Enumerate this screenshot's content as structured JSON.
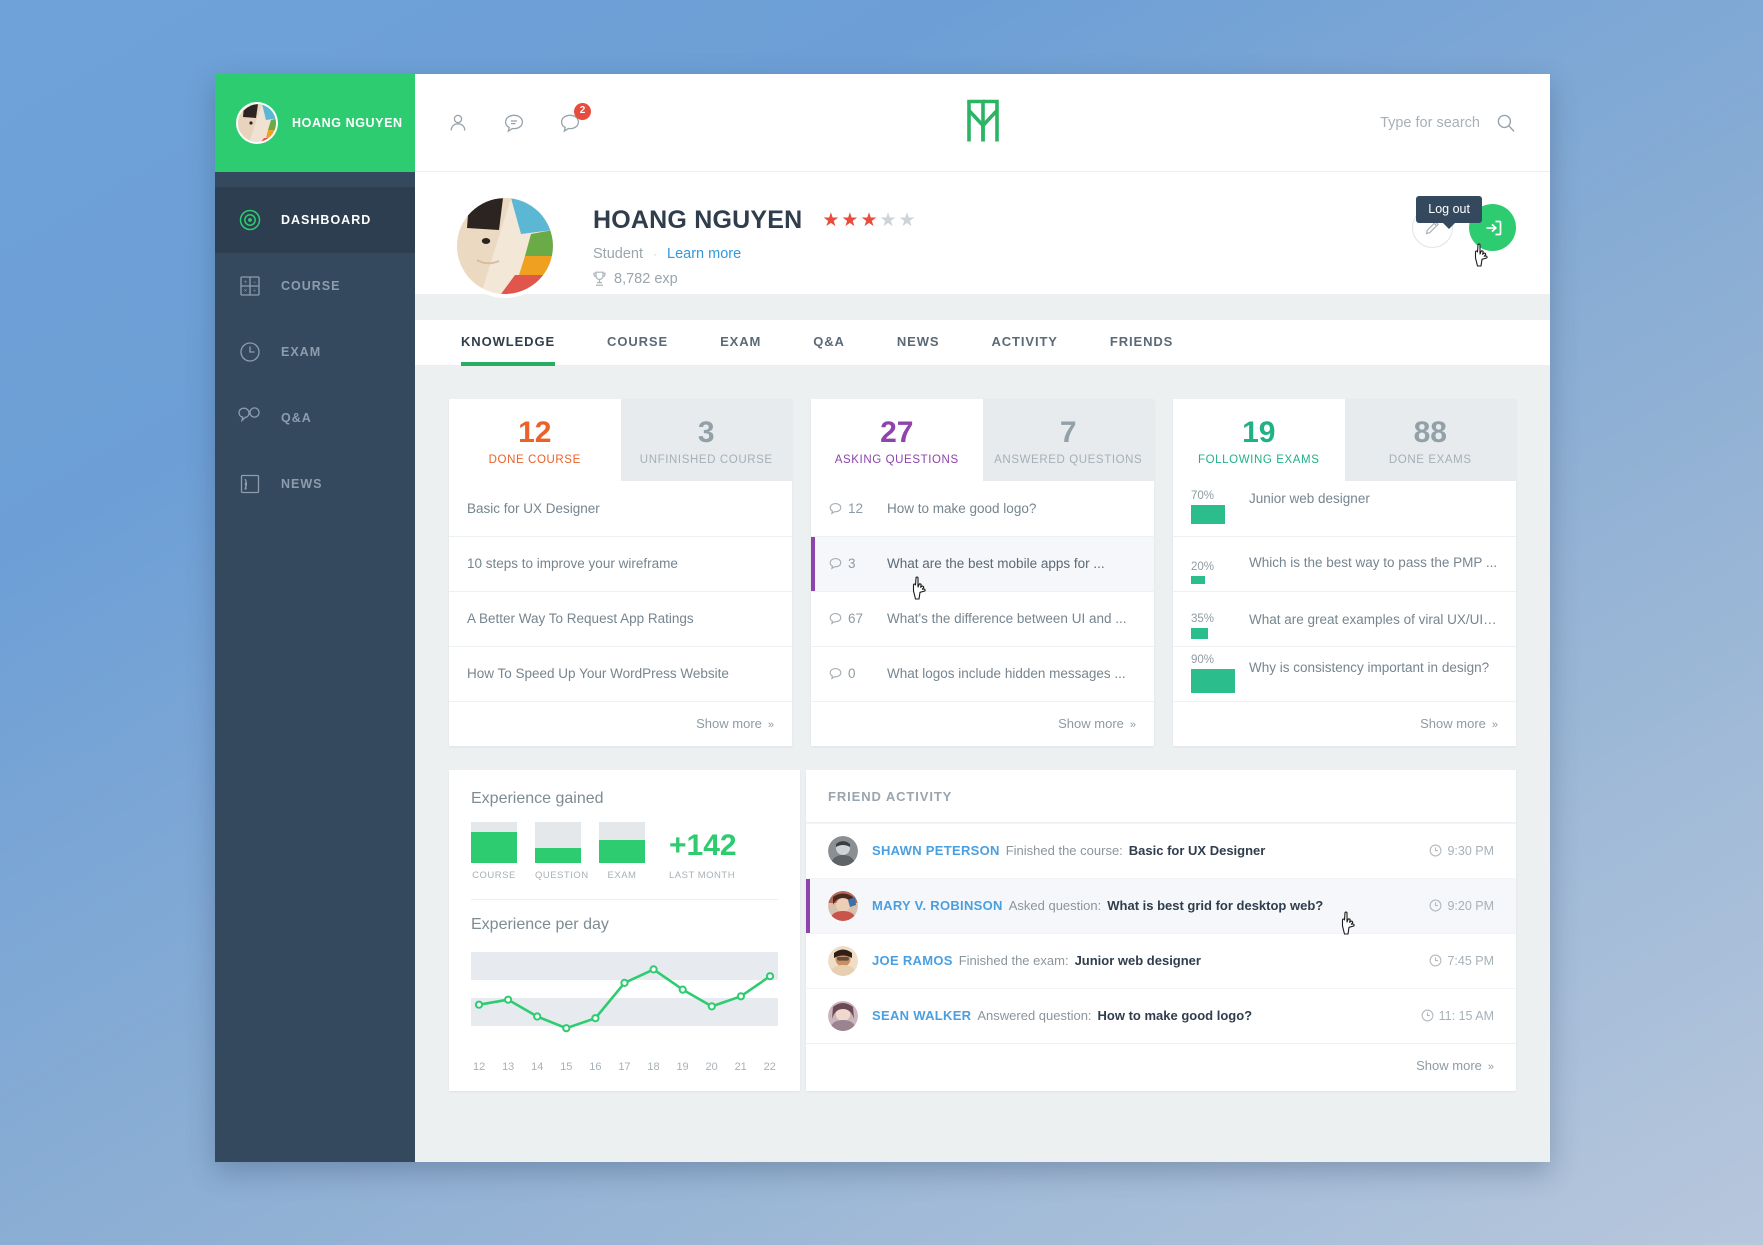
{
  "brand": {
    "name": "HOANG NGUYEN",
    "logo": "logo-n-mark"
  },
  "sidebar": {
    "items": [
      {
        "label": "DASHBOARD",
        "icon": "dashboard-target-icon",
        "active": true
      },
      {
        "label": "COURSE",
        "icon": "calculator-icon",
        "active": false
      },
      {
        "label": "EXAM",
        "icon": "clock-icon",
        "active": false
      },
      {
        "label": "Q&A",
        "icon": "speech-bubbles-icon",
        "active": false
      },
      {
        "label": "NEWS",
        "icon": "rss-icon",
        "active": false
      }
    ]
  },
  "topbar": {
    "icons": [
      {
        "name": "friends-icon",
        "badge": ""
      },
      {
        "name": "messages-icon",
        "badge": ""
      },
      {
        "name": "notifications-icon",
        "badge": "2"
      }
    ],
    "search": {
      "placeholder": "Type for search",
      "value": "",
      "icon": "search-icon"
    }
  },
  "profile": {
    "name": "HOANG NGUYEN",
    "rating": 3,
    "rating_max": 5,
    "role": "Student",
    "separator": "·",
    "learn_more": "Learn more",
    "exp": "8,782 exp",
    "exp_icon": "trophy-icon",
    "edit_icon": "pencil-icon",
    "logout_icon": "logout-arrow-icon",
    "logout_tooltip": "Log out"
  },
  "tabs": [
    {
      "label": "KNOWLEDGE",
      "active": true
    },
    {
      "label": "COURSE",
      "active": false
    },
    {
      "label": "EXAM",
      "active": false
    },
    {
      "label": "Q&A",
      "active": false
    },
    {
      "label": "NEWS",
      "active": false
    },
    {
      "label": "ACTIVITY",
      "active": false
    },
    {
      "label": "FRIENDS",
      "active": false
    }
  ],
  "cards": {
    "course": {
      "primary": {
        "value": "12",
        "label": "DONE COURSE",
        "color": "#e8622a"
      },
      "secondary": {
        "value": "3",
        "label": "UNFINISHED COURSE"
      },
      "rows": [
        {
          "text": "Basic for UX Designer"
        },
        {
          "text": "10 steps to improve your wireframe"
        },
        {
          "text": "A Better Way To Request App Ratings"
        },
        {
          "text": "How To Speed Up Your WordPress Website"
        }
      ],
      "show_more": "Show more"
    },
    "questions": {
      "primary": {
        "value": "27",
        "label": "ASKING QUESTIONS",
        "color": "#8e44ad"
      },
      "secondary": {
        "value": "7",
        "label": "ANSWERED QUESTIONS"
      },
      "rows": [
        {
          "count": "12",
          "text": "How to make good logo?",
          "highlight": false
        },
        {
          "count": "3",
          "text": "What are the best mobile apps for ...",
          "highlight": true
        },
        {
          "count": "67",
          "text": "What's the difference between UI and ...",
          "highlight": false
        },
        {
          "count": "0",
          "text": "What logos include hidden messages ...",
          "highlight": false
        }
      ],
      "show_more": "Show more"
    },
    "exams": {
      "primary": {
        "value": "19",
        "label": "FOLLOWING EXAMS",
        "color": "#20b187"
      },
      "secondary": {
        "value": "88",
        "label": "DONE EXAMS"
      },
      "rows": [
        {
          "pct": "70%",
          "pct_num": 70,
          "text": "Junior web designer"
        },
        {
          "pct": "20%",
          "pct_num": 20,
          "text": "Which is the best way to pass the PMP ..."
        },
        {
          "pct": "35%",
          "pct_num": 35,
          "text": "What are great examples of viral UX/UI ..."
        },
        {
          "pct": "90%",
          "pct_num": 90,
          "text": "Why is consistency important in design?"
        }
      ],
      "show_more": "Show more"
    }
  },
  "experience": {
    "gained_title": "Experience gained",
    "per_day_title": "Experience per day",
    "bars": [
      {
        "label": "COURSE",
        "pct": 75
      },
      {
        "label": "QUESTION",
        "pct": 35
      },
      {
        "label": "EXAM",
        "pct": 55
      }
    ],
    "total": "+142",
    "total_label": "LAST MONTH"
  },
  "chart_data": {
    "type": "line",
    "title": "Experience per day",
    "xlabel": "",
    "ylabel": "",
    "x": [
      "12",
      "13",
      "14",
      "15",
      "16",
      "17",
      "18",
      "19",
      "20",
      "21",
      "22"
    ],
    "categories": [
      "12",
      "13",
      "14",
      "15",
      "16",
      "17",
      "18",
      "19",
      "20",
      "21",
      "22"
    ],
    "values": [
      42,
      48,
      28,
      14,
      26,
      68,
      84,
      60,
      40,
      52,
      76
    ],
    "series": [
      {
        "name": "Experience",
        "values": [
          42,
          48,
          28,
          14,
          26,
          68,
          84,
          60,
          40,
          52,
          76
        ]
      }
    ],
    "ylim": [
      0,
      100
    ],
    "grid": true,
    "legend": "none",
    "line_color": "#2ecc71",
    "marker": "open-circle"
  },
  "friend_activity": {
    "title": "FRIEND ACTIVITY",
    "rows": [
      {
        "user": "SHAWN PETERSON",
        "verb": "Finished the course:",
        "object": "Basic for UX Designer",
        "time": "9:30 PM",
        "highlight": false
      },
      {
        "user": "MARY V. ROBINSON",
        "verb": "Asked question:",
        "object": "What is best grid for desktop web?",
        "time": "9:20 PM",
        "highlight": true
      },
      {
        "user": "JOE RAMOS",
        "verb": "Finished the exam:",
        "object": "Junior web designer",
        "time": "7:45 PM",
        "highlight": false
      },
      {
        "user": "SEAN WALKER",
        "verb": "Answered question:",
        "object": "How to make good logo?",
        "time": "11: 15 AM",
        "highlight": false
      }
    ],
    "show_more": "Show more",
    "time_icon": "clock-icon"
  },
  "colors": {
    "green": "#2ecc71",
    "dark_navy": "#34495e",
    "orange": "#e8622a",
    "purple": "#8e44ad",
    "teal": "#20b187",
    "blue_link": "#3498db",
    "red_badge": "#e74c3c"
  }
}
